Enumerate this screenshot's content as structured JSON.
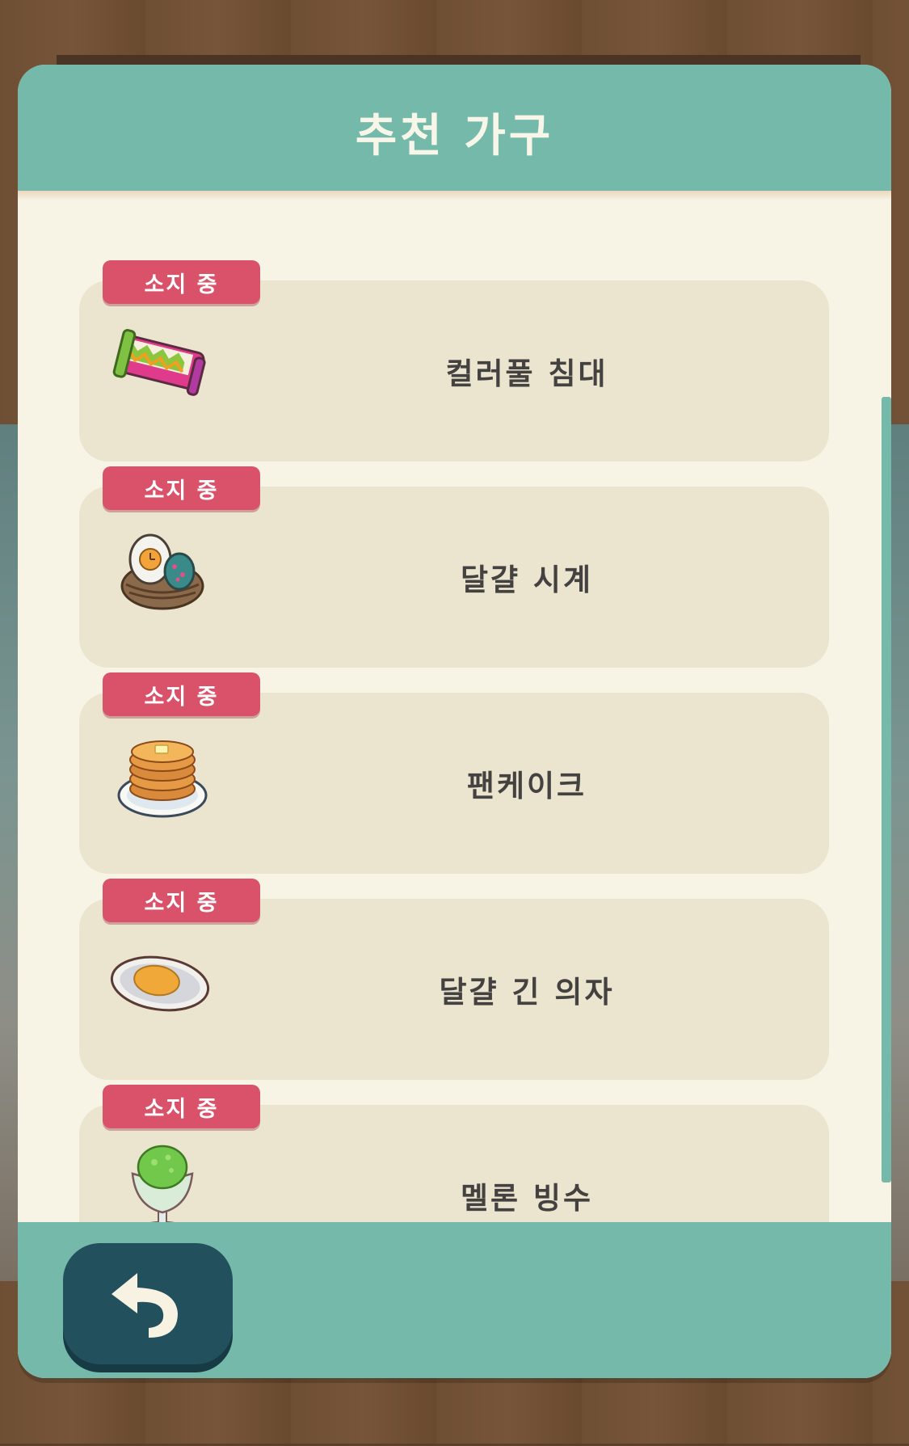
{
  "dialog": {
    "title": "추천 가구"
  },
  "items": [
    {
      "badge": "소지 중",
      "name": "컬러풀 침대",
      "icon": "colorful-bed-icon"
    },
    {
      "badge": "소지 중",
      "name": "달걀 시계",
      "icon": "egg-clock-icon"
    },
    {
      "badge": "소지 중",
      "name": "팬케이크",
      "icon": "pancake-icon"
    },
    {
      "badge": "소지 중",
      "name": "달걀 긴 의자",
      "icon": "egg-bench-icon"
    },
    {
      "badge": "소지 중",
      "name": "멜론 빙수",
      "icon": "melon-shaved-ice-icon"
    }
  ],
  "footer": {
    "back_icon": "undo-arrow-icon"
  },
  "colors": {
    "teal": "#74b9aa",
    "badge_red": "#d9526a",
    "card_beige": "#ebe4cf",
    "panel_cream": "#f7f4e6",
    "back_button": "#22505c"
  }
}
